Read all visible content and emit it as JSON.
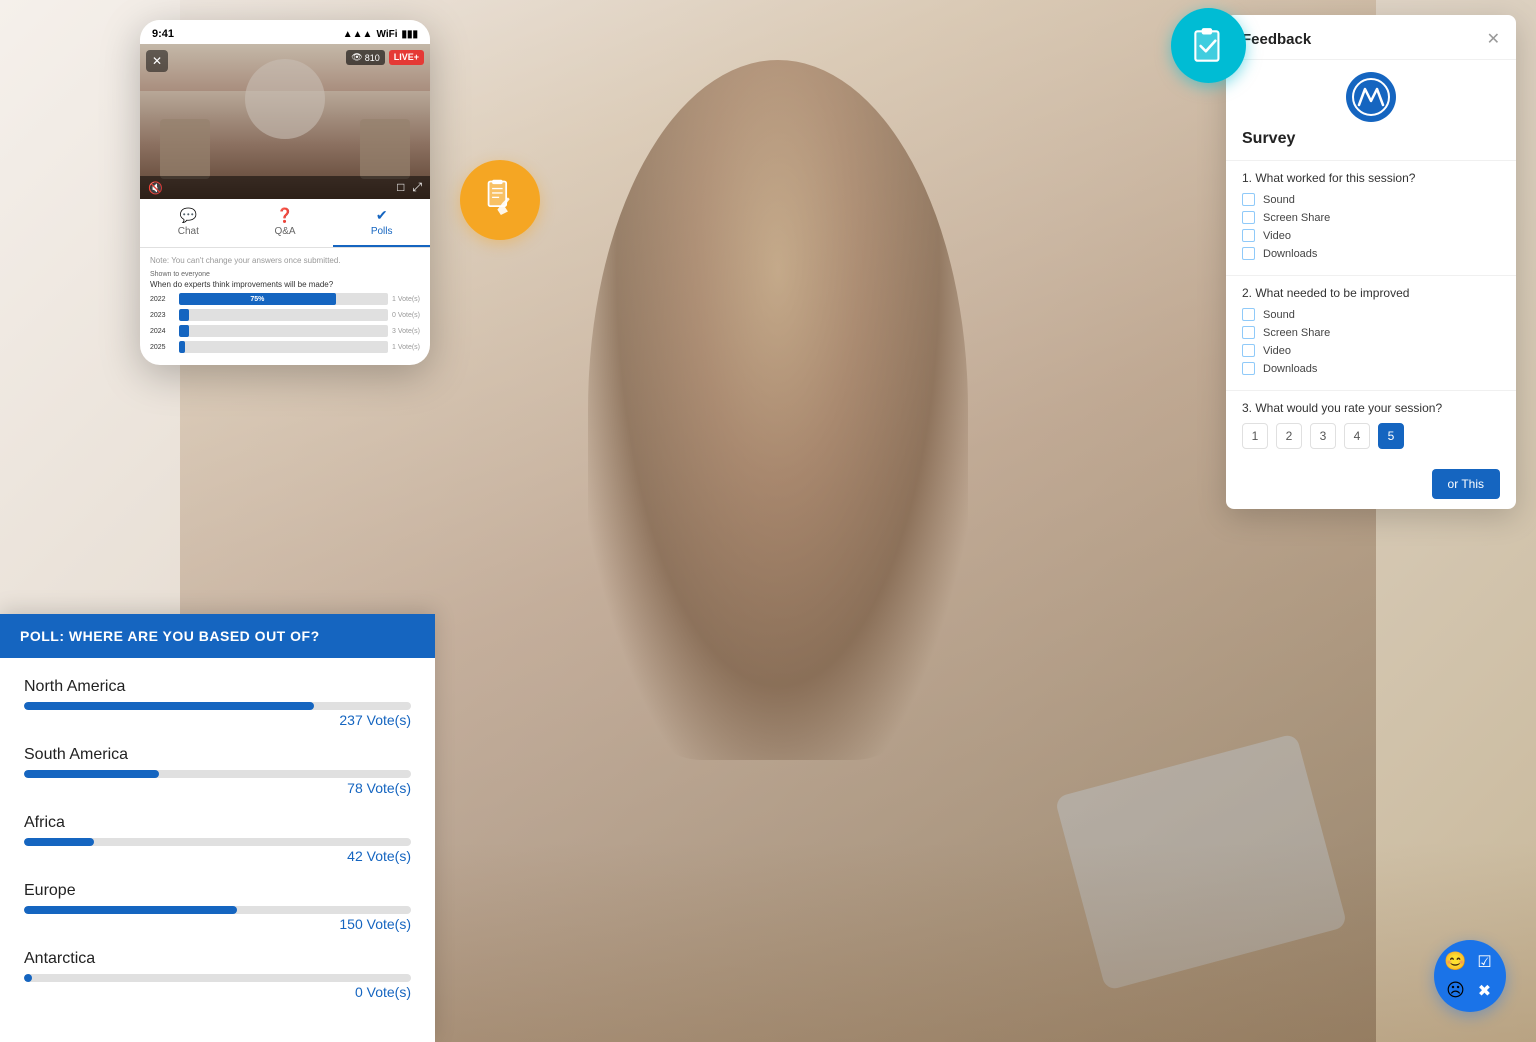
{
  "background": {
    "color": "#f0ebe4"
  },
  "orange_icon": {
    "label": "survey-click-icon",
    "symbol": "📋"
  },
  "cyan_icon": {
    "label": "clipboard-check-icon"
  },
  "phone": {
    "status_bar": {
      "time": "9:41",
      "signal": "📶",
      "wifi": "WiFi",
      "battery": "🔋"
    },
    "video": {
      "views": "810",
      "live_badge": "LIVE+",
      "close": "✕"
    },
    "tabs": [
      {
        "label": "Chat",
        "active": false
      },
      {
        "label": "Q&A",
        "active": false
      },
      {
        "label": "Polls",
        "active": true
      }
    ],
    "poll_note": "Note: You can't change your answers once submitted.",
    "poll_question": "When do experts think improvements will be made?",
    "poll_label": "Shown to everyone",
    "poll_bars": [
      {
        "year": "2022",
        "pct": "75%",
        "fill": 75,
        "votes": "1 Vote(s)"
      },
      {
        "year": "2023",
        "pct": "0%",
        "fill": 0,
        "votes": "0 Vote(s)"
      },
      {
        "year": "2024",
        "pct": "0%",
        "fill": 0,
        "votes": "3 Vote(s)"
      },
      {
        "year": "2025",
        "pct": "0%",
        "fill": 0,
        "votes": "1 Vote(s)"
      }
    ]
  },
  "poll_panel": {
    "header": "POLL: WHERE ARE YOU BASED OUT OF?",
    "regions": [
      {
        "name": "North America",
        "fill_pct": 75,
        "votes": "237 Vote(s)"
      },
      {
        "name": "South America",
        "fill_pct": 35,
        "votes": "78 Vote(s)"
      },
      {
        "name": "Africa",
        "fill_pct": 18,
        "votes": "42 Vote(s)"
      },
      {
        "name": "Europe",
        "fill_pct": 55,
        "votes": "150 Vote(s)"
      },
      {
        "name": "Antarctica",
        "fill_pct": 2,
        "votes": "0 Vote(s)"
      }
    ]
  },
  "feedback_panel": {
    "title": "Feedback",
    "close_label": "✕",
    "survey_title": "Survey",
    "questions": [
      {
        "number": "1.",
        "text": "What worked for this session?",
        "options": [
          "Sound",
          "Screen Share",
          "Video",
          "Downloads"
        ]
      },
      {
        "number": "2.",
        "text": "What needed to be improved",
        "options": [
          "Sound",
          "Screen Share",
          "Video",
          "Downloads"
        ]
      },
      {
        "number": "3.",
        "text": "What would you rate your session?",
        "ratings": [
          1,
          2,
          3,
          4,
          5
        ],
        "active_rating": 5
      }
    ],
    "submit_label": "or This"
  },
  "bottom_right": {
    "icons": [
      "😊",
      "☑",
      "☹",
      "✖"
    ]
  }
}
